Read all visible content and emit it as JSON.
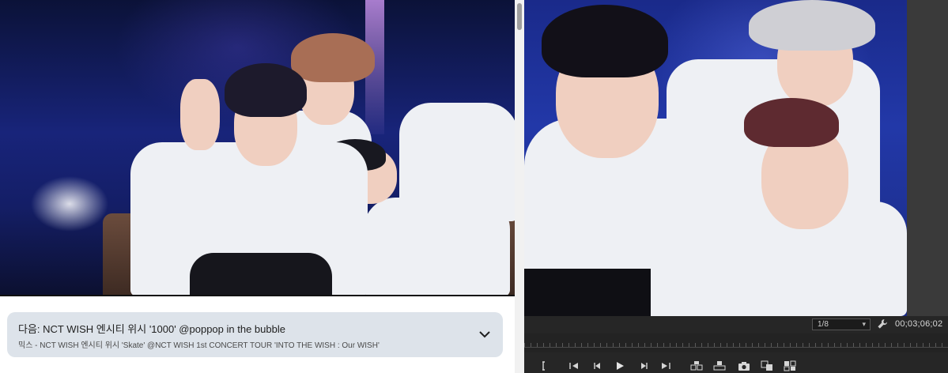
{
  "youtube": {
    "up_next": {
      "title": "다음: NCT WISH 엔시티 위시 '1000' @poppop in the bubble",
      "subtitle": "믹스 - NCT WISH 엔시티 위시 'Skate' @NCT WISH 1st CONCERT TOUR 'INTO THE WISH : Our WISH'",
      "icon": "chevron-down-icon"
    }
  },
  "editor": {
    "zoom_value": "1/8",
    "timecode": "00;03;06;02",
    "icons": [
      "wrench-icon",
      "mark-in-icon",
      "go-to-in-icon",
      "step-back-icon",
      "play-icon",
      "step-forward-icon",
      "go-to-out-icon",
      "insert-icon",
      "overwrite-icon",
      "export-frame-icon",
      "compare-icon",
      "multi-camera-icon"
    ]
  },
  "colors": {
    "up_next_bg": "#dde3ea",
    "editor_bg": "#262626",
    "timecode": "#d8d8d8"
  }
}
